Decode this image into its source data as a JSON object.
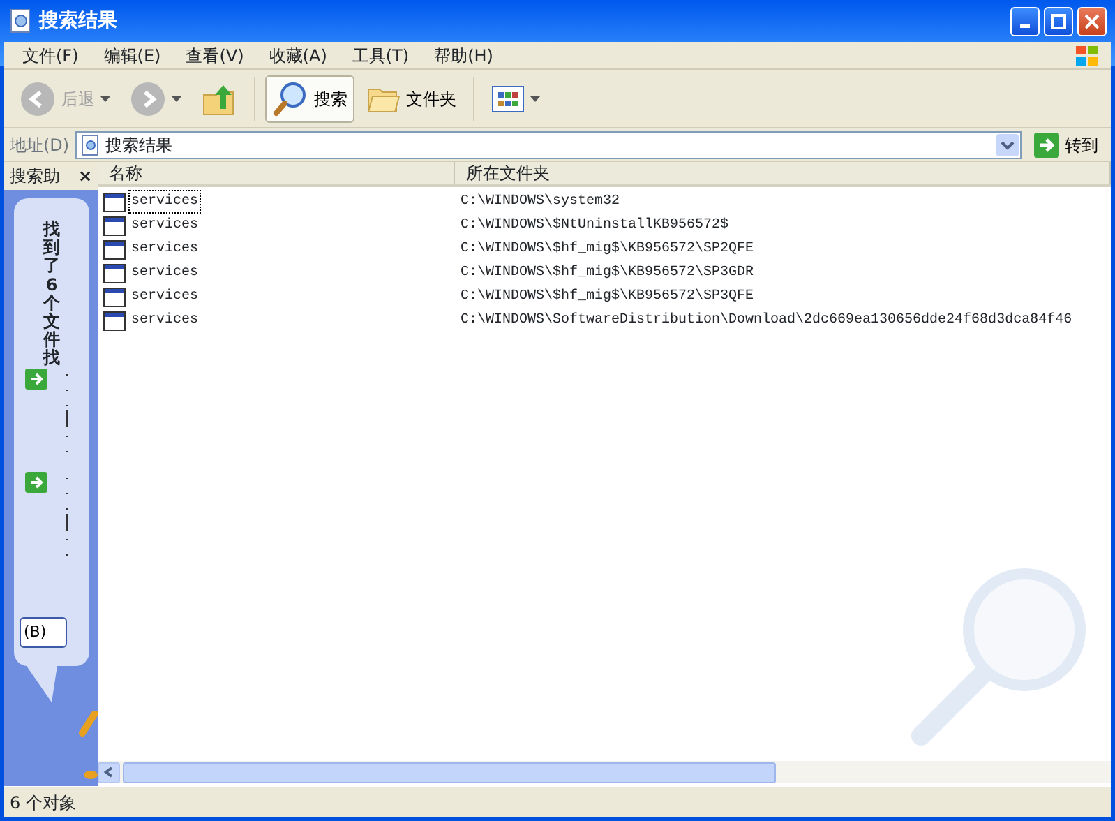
{
  "window": {
    "title": "搜索结果"
  },
  "menu": [
    {
      "label": "文件(F)"
    },
    {
      "label": "编辑(E)"
    },
    {
      "label": "查看(V)"
    },
    {
      "label": "收藏(A)"
    },
    {
      "label": "工具(T)"
    },
    {
      "label": "帮助(H)"
    }
  ],
  "toolbar": [
    {
      "kind": "back",
      "label": "后退",
      "disabled": true
    },
    {
      "kind": "forward",
      "disabled": true
    },
    {
      "kind": "up",
      "disabled": false
    },
    {
      "kind": "search",
      "label": "搜索",
      "selected": true
    },
    {
      "kind": "folders",
      "label": "文件夹",
      "selected": false
    },
    {
      "kind": "views"
    }
  ],
  "address": {
    "label": "地址(D)",
    "value": "搜索结果",
    "go": "转到"
  },
  "sidebar": {
    "title": "搜索助",
    "close": "×",
    "message": "找到了6个文件找",
    "button": "(B)"
  },
  "table": {
    "columns": [
      "名称",
      "所在文件夹"
    ],
    "rows": [
      {
        "name": "services",
        "folder": "C:\\WINDOWS\\system32",
        "selected": true
      },
      {
        "name": "services",
        "folder": "C:\\WINDOWS\\$NtUninstallKB956572$",
        "selected": false
      },
      {
        "name": "services",
        "folder": "C:\\WINDOWS\\$hf_mig$\\KB956572\\SP2QFE",
        "selected": false
      },
      {
        "name": "services",
        "folder": "C:\\WINDOWS\\$hf_mig$\\KB956572\\SP3GDR",
        "selected": false
      },
      {
        "name": "services",
        "folder": "C:\\WINDOWS\\$hf_mig$\\KB956572\\SP3QFE",
        "selected": false
      },
      {
        "name": "services",
        "folder": "C:\\WINDOWS\\SoftwareDistribution\\Download\\2dc669ea130656dde24f68d3dca84f46",
        "selected": false
      }
    ]
  },
  "status_bar": "6 个对象"
}
